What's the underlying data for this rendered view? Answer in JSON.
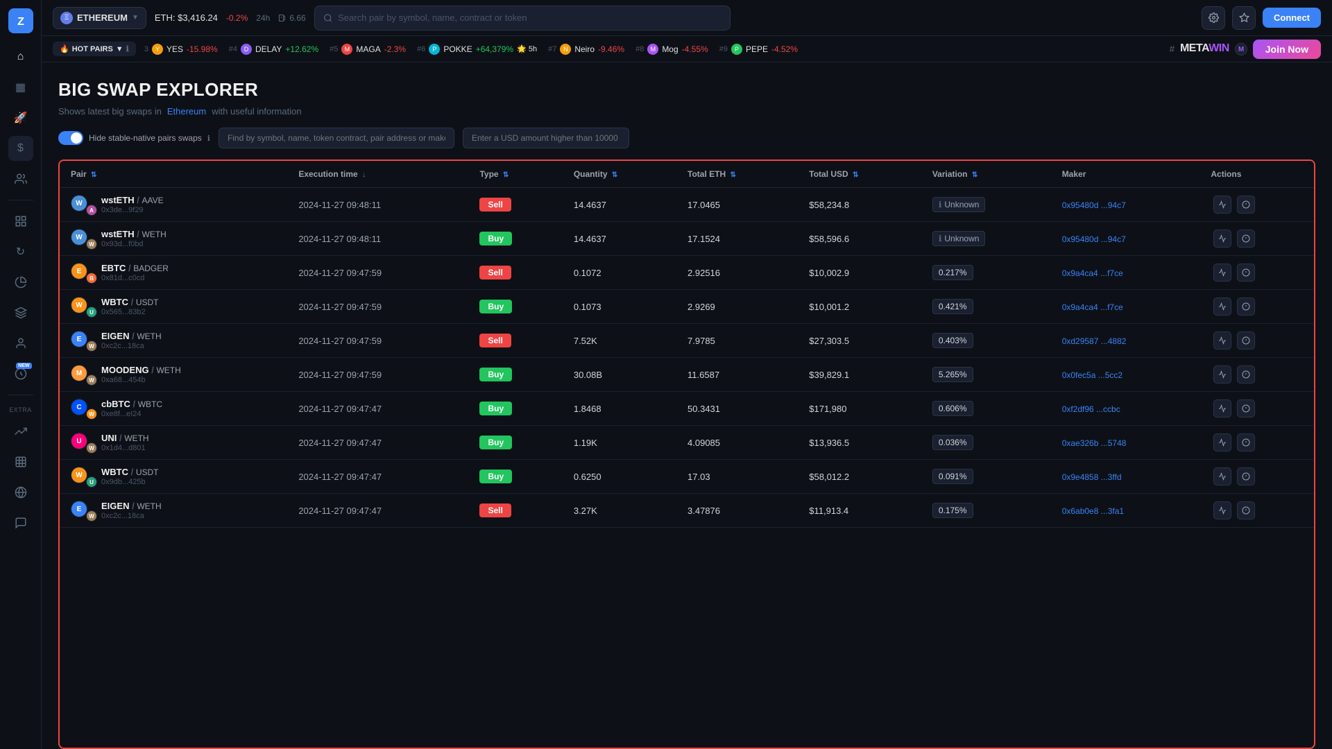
{
  "sidebar": {
    "logo": "Z",
    "items": [
      {
        "id": "home",
        "icon": "⌂",
        "active": false
      },
      {
        "id": "dashboard",
        "icon": "▦",
        "active": false
      },
      {
        "id": "rocket",
        "icon": "🚀",
        "active": false
      },
      {
        "id": "dollar",
        "icon": "$",
        "active": true
      },
      {
        "id": "users",
        "icon": "👥",
        "active": false
      },
      {
        "id": "widgets",
        "icon": "⊞",
        "active": false
      },
      {
        "id": "refresh",
        "icon": "↻",
        "active": false
      },
      {
        "id": "pie",
        "icon": "◑",
        "active": false
      },
      {
        "id": "layers",
        "icon": "⧉",
        "active": false
      },
      {
        "id": "person",
        "icon": "👤",
        "active": false
      },
      {
        "id": "face",
        "icon": "😊",
        "active": false,
        "new": true
      }
    ],
    "extra_label": "EXTRA",
    "extra_items": [
      {
        "id": "chart2",
        "icon": "📈"
      },
      {
        "id": "table",
        "icon": "📊"
      },
      {
        "id": "globe",
        "icon": "🌐"
      },
      {
        "id": "feedback",
        "icon": "💬"
      }
    ]
  },
  "topbar": {
    "chain": "ETHEREUM",
    "chain_icon": "Ξ",
    "eth_price": "ETH: $3,416.24",
    "eth_change": "-0.2%",
    "eth_change_period": "24h",
    "gas": "6.66",
    "search_placeholder": "Search pair by symbol, name, contract or token"
  },
  "ticker": {
    "hot_pairs_label": "HOT PAIRS",
    "items": [
      {
        "rank": "3",
        "name": "YES",
        "change": "-15.98%",
        "positive": false
      },
      {
        "rank": "#4",
        "name": "DELAY",
        "change": "+12.62%",
        "positive": true
      },
      {
        "rank": "#5",
        "name": "MAGA",
        "change": "-2.3%",
        "positive": false
      },
      {
        "rank": "#6",
        "name": "POKKE",
        "change": "+64,379%",
        "positive": true,
        "extra": "🌟 5h"
      },
      {
        "rank": "#7",
        "name": "Neiro",
        "change": "-9.46%",
        "positive": false
      },
      {
        "rank": "#8",
        "name": "Mog",
        "change": "-4.55%",
        "positive": false
      },
      {
        "rank": "#9",
        "name": "PEPE",
        "change": "-4.52%",
        "positive": false
      }
    ],
    "metawin_label": "METAWIN",
    "join_now_label": "Join Now"
  },
  "page": {
    "title": "BIG SWAP EXPLORER",
    "subtitle": "Shows latest big swaps in",
    "chain_link": "Ethereum",
    "subtitle_rest": "with useful information",
    "toggle_label": "Hide stable-native pairs swaps",
    "filter_placeholder": "Find by symbol, name, token contract, pair address or maker",
    "amount_placeholder": "Enter a USD amount higher than 10000"
  },
  "table": {
    "columns": [
      {
        "id": "pair",
        "label": "Pair",
        "sortable": true,
        "sort_active": false
      },
      {
        "id": "execution_time",
        "label": "Execution time",
        "sortable": true,
        "sort_active": true
      },
      {
        "id": "type",
        "label": "Type",
        "sortable": true
      },
      {
        "id": "quantity",
        "label": "Quantity",
        "sortable": true
      },
      {
        "id": "total_eth",
        "label": "Total ETH",
        "sortable": true
      },
      {
        "id": "total_usd",
        "label": "Total USD",
        "sortable": true
      },
      {
        "id": "variation",
        "label": "Variation",
        "sortable": true
      },
      {
        "id": "maker",
        "label": "Maker",
        "sortable": false
      },
      {
        "id": "actions",
        "label": "Actions",
        "sortable": false
      }
    ],
    "rows": [
      {
        "pair_main": "wstETH",
        "pair_secondary": "AAVE",
        "pair_address": "0x3de...9f29",
        "pair_color_main": "#4a90d9",
        "pair_color_secondary": "#b6509e",
        "pair_letter_main": "W",
        "pair_letter_secondary": "A",
        "execution_time": "2024-11-27 09:48:11",
        "type": "Sell",
        "quantity": "14.4637",
        "total_eth": "17.0465",
        "total_usd": "$58,234.8",
        "variation": "Unknown",
        "variation_type": "unknown",
        "maker": "0x95480d ...94c7",
        "maker_full": "0x95480d...94c7"
      },
      {
        "pair_main": "wstETH",
        "pair_secondary": "WETH",
        "pair_address": "0x93d...f0bd",
        "pair_color_main": "#4a90d9",
        "pair_color_secondary": "#9b7e59",
        "pair_letter_main": "W",
        "pair_letter_secondary": "W",
        "execution_time": "2024-11-27 09:48:11",
        "type": "Buy",
        "quantity": "14.4637",
        "total_eth": "17.1524",
        "total_usd": "$58,596.6",
        "variation": "Unknown",
        "variation_type": "unknown",
        "maker": "0x95480d ...94c7",
        "maker_full": "0x95480d...94c7"
      },
      {
        "pair_main": "EBTC",
        "pair_secondary": "BADGER",
        "pair_address": "0x81d...c0cd",
        "pair_color_main": "#f7931a",
        "pair_color_secondary": "#ff6b35",
        "pair_letter_main": "E",
        "pair_letter_secondary": "B",
        "execution_time": "2024-11-27 09:47:59",
        "type": "Sell",
        "quantity": "0.1072",
        "total_eth": "2.92516",
        "total_usd": "$10,002.9",
        "variation": "0.217%",
        "variation_type": "value",
        "maker": "0x9a4ca4 ...f7ce",
        "maker_full": "0x9a4ca4...f7ce"
      },
      {
        "pair_main": "WBTC",
        "pair_secondary": "USDT",
        "pair_address": "0x565...83b2",
        "pair_color_main": "#f7931a",
        "pair_color_secondary": "#26a17b",
        "pair_letter_main": "W",
        "pair_letter_secondary": "U",
        "execution_time": "2024-11-27 09:47:59",
        "type": "Buy",
        "quantity": "0.1073",
        "total_eth": "2.9269",
        "total_usd": "$10,001.2",
        "variation": "0.421%",
        "variation_type": "value",
        "maker": "0x9a4ca4 ...f7ce",
        "maker_full": "0x9a4ca4...f7ce"
      },
      {
        "pair_main": "EIGEN",
        "pair_secondary": "WETH",
        "pair_address": "0xc2c...18ca",
        "pair_color_main": "#3b82f6",
        "pair_color_secondary": "#9b7e59",
        "pair_letter_main": "E",
        "pair_letter_secondary": "W",
        "execution_time": "2024-11-27 09:47:59",
        "type": "Sell",
        "quantity": "7.52K",
        "total_eth": "7.9785",
        "total_usd": "$27,303.5",
        "variation": "0.403%",
        "variation_type": "value",
        "maker": "0xd29587 ...4882",
        "maker_full": "0xd29587...4882"
      },
      {
        "pair_main": "MOODENG",
        "pair_secondary": "WETH",
        "pair_address": "0xa68...454b",
        "pair_color_main": "#ff9a3c",
        "pair_color_secondary": "#9b7e59",
        "pair_letter_main": "M",
        "pair_letter_secondary": "W",
        "execution_time": "2024-11-27 09:47:59",
        "type": "Buy",
        "quantity": "30.08B",
        "total_eth": "11.6587",
        "total_usd": "$39,829.1",
        "variation": "5.265%",
        "variation_type": "value",
        "maker": "0x0fec5a ...5cc2",
        "maker_full": "0x0fec5a...5cc2"
      },
      {
        "pair_main": "cbBTC",
        "pair_secondary": "WBTC",
        "pair_address": "0xe8f...eI24",
        "pair_color_main": "#0052ff",
        "pair_color_secondary": "#f7931a",
        "pair_letter_main": "C",
        "pair_letter_secondary": "W",
        "execution_time": "2024-11-27 09:47:47",
        "type": "Buy",
        "quantity": "1.8468",
        "total_eth": "50.3431",
        "total_usd": "$171,980",
        "variation": "0.606%",
        "variation_type": "value",
        "maker": "0xf2df96 ...ccbc",
        "maker_full": "0xf2df96...ccbc"
      },
      {
        "pair_main": "UNI",
        "pair_secondary": "WETH",
        "pair_address": "0x1d4...d801",
        "pair_color_main": "#ff007a",
        "pair_color_secondary": "#9b7e59",
        "pair_letter_main": "U",
        "pair_letter_secondary": "W",
        "execution_time": "2024-11-27 09:47:47",
        "type": "Buy",
        "quantity": "1.19K",
        "total_eth": "4.09085",
        "total_usd": "$13,936.5",
        "variation": "0.036%",
        "variation_type": "value",
        "maker": "0xae326b ...5748",
        "maker_full": "0xae326b...5748"
      },
      {
        "pair_main": "WBTC",
        "pair_secondary": "USDT",
        "pair_address": "0x9db...425b",
        "pair_color_main": "#f7931a",
        "pair_color_secondary": "#26a17b",
        "pair_letter_main": "W",
        "pair_letter_secondary": "U",
        "execution_time": "2024-11-27 09:47:47",
        "type": "Buy",
        "quantity": "0.6250",
        "total_eth": "17.03",
        "total_usd": "$58,012.2",
        "variation": "0.091%",
        "variation_type": "value",
        "maker": "0x9e4858 ...3ffd",
        "maker_full": "0x9e4858...3ffd"
      },
      {
        "pair_main": "EIGEN",
        "pair_secondary": "WETH",
        "pair_address": "0xc2c...18ca",
        "pair_color_main": "#3b82f6",
        "pair_color_secondary": "#9b7e59",
        "pair_letter_main": "E",
        "pair_letter_secondary": "W",
        "execution_time": "2024-11-27 09:47:47",
        "type": "Sell",
        "quantity": "3.27K",
        "total_eth": "3.47876",
        "total_usd": "$11,913.4",
        "variation": "0.175%",
        "variation_type": "value",
        "maker": "0x6ab0e8 ...3fa1",
        "maker_full": "0x6ab0e8...3fa1"
      }
    ]
  }
}
